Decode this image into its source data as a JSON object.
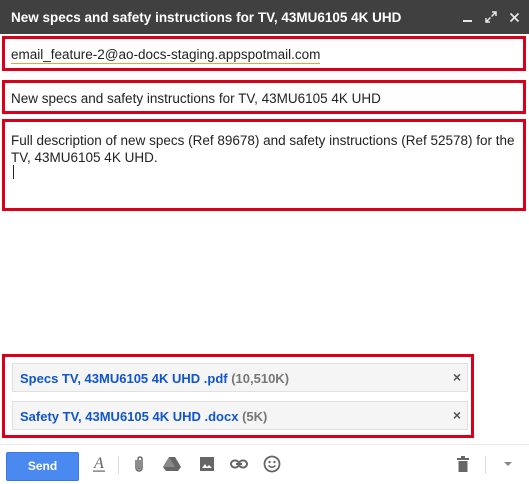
{
  "window": {
    "title": "New specs and safety instructions for TV, 43MU6105 4K UHD",
    "minimize_icon": "minimize-icon",
    "popout_icon": "popout-icon",
    "close_icon": "close-icon"
  },
  "recipients": {
    "to": "email_feature-2@ao-docs-staging.appspotmail.com"
  },
  "subject": {
    "value": "New specs and safety instructions for TV, 43MU6105 4K UHD"
  },
  "body": {
    "text": "Full description of new specs (Ref 89678) and safety instructions (Ref 52578) for the TV, 43MU6105 4K UHD."
  },
  "attachments": [
    {
      "name": "Specs TV, 43MU6105 4K UHD .pdf",
      "size": "(10,510K)"
    },
    {
      "name": "Safety TV, 43MU6105 4K UHD .docx",
      "size": "(5K)"
    }
  ],
  "toolbar": {
    "send_label": "Send",
    "icons": [
      "formatting-icon",
      "attach-icon",
      "drive-icon",
      "photo-icon",
      "link-icon",
      "emoji-icon",
      "trash-icon",
      "more-options-icon"
    ]
  },
  "colors": {
    "titlebar": "#404040",
    "highlight_border": "#d9001b",
    "send_button": "#4a89f0",
    "attachment_link": "#1155cc"
  }
}
